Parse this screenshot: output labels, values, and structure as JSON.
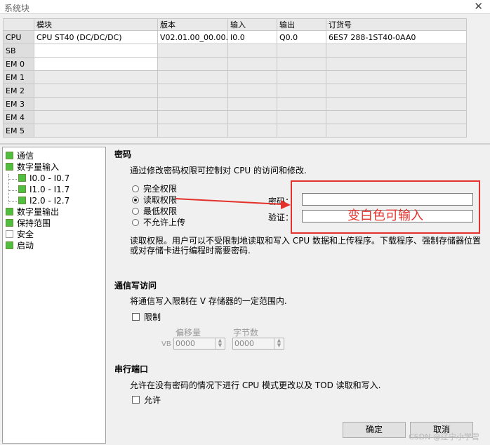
{
  "window": {
    "title": "系统块",
    "close_glyph": "✕"
  },
  "module_table": {
    "headers": [
      "",
      "模块",
      "版本",
      "输入",
      "输出",
      "订货号"
    ],
    "rows": [
      {
        "slot": "CPU",
        "module": "CPU ST40 (DC/DC/DC)",
        "version": "V02.01.00_00.00...",
        "input": "I0.0",
        "output": "Q0.0",
        "order": "6ES7 288-1ST40-0AA0"
      },
      {
        "slot": "SB",
        "module": "",
        "version": "",
        "input": "",
        "output": "",
        "order": ""
      },
      {
        "slot": "EM 0",
        "module": "",
        "version": "",
        "input": "",
        "output": "",
        "order": ""
      },
      {
        "slot": "EM 1",
        "module": "",
        "version": "",
        "input": "",
        "output": "",
        "order": ""
      },
      {
        "slot": "EM 2",
        "module": "",
        "version": "",
        "input": "",
        "output": "",
        "order": ""
      },
      {
        "slot": "EM 3",
        "module": "",
        "version": "",
        "input": "",
        "output": "",
        "order": ""
      },
      {
        "slot": "EM 4",
        "module": "",
        "version": "",
        "input": "",
        "output": "",
        "order": ""
      },
      {
        "slot": "EM 5",
        "module": "",
        "version": "",
        "input": "",
        "output": "",
        "order": ""
      }
    ]
  },
  "tree": {
    "items": [
      {
        "label": "通信",
        "checked": true
      },
      {
        "label": "数字量输入",
        "checked": true
      },
      {
        "label": "I0.0 - I0.7",
        "checked": true
      },
      {
        "label": "I1.0 - I1.7",
        "checked": true
      },
      {
        "label": "I2.0 - I2.7",
        "checked": true
      },
      {
        "label": "数字量输出",
        "checked": true
      },
      {
        "label": "保持范围",
        "checked": true
      },
      {
        "label": "安全",
        "checked": false
      },
      {
        "label": "启动",
        "checked": true
      }
    ]
  },
  "password": {
    "heading": "密码",
    "description": "通过修改密码权限可控制对 CPU 的访问和修改.",
    "options": [
      "完全权限",
      "读取权限",
      "最低权限",
      "不允许上传"
    ],
    "selected_index": 1,
    "password_label": "密码：",
    "verify_label": "验证：",
    "note_line1": "读取权限。用户可以不受限制地读取和写入 CPU 数据和上传程序。下载程序、强制存储器位置",
    "note_line2": "或对存储卡进行编程时需要密码."
  },
  "comm_write": {
    "heading": "通信写访问",
    "description": "将通信写入限制在 V 存储器的一定范围内.",
    "restrict_label": "限制",
    "offset_label": "偏移量",
    "bytes_label": "字节数",
    "vb_label": "VB",
    "offset_value": "0000",
    "bytes_value": "0000"
  },
  "serial_port": {
    "heading": "串行端口",
    "description": "允许在没有密码的情况下进行 CPU 模式更改以及 TOD 读取和写入.",
    "allow_label": "允许"
  },
  "buttons": {
    "ok": "确定",
    "cancel": "取消"
  },
  "annotation": {
    "text": "变白色可输入",
    "color": "#e4312b"
  },
  "watermark": "CSDN @辽宁小学营"
}
